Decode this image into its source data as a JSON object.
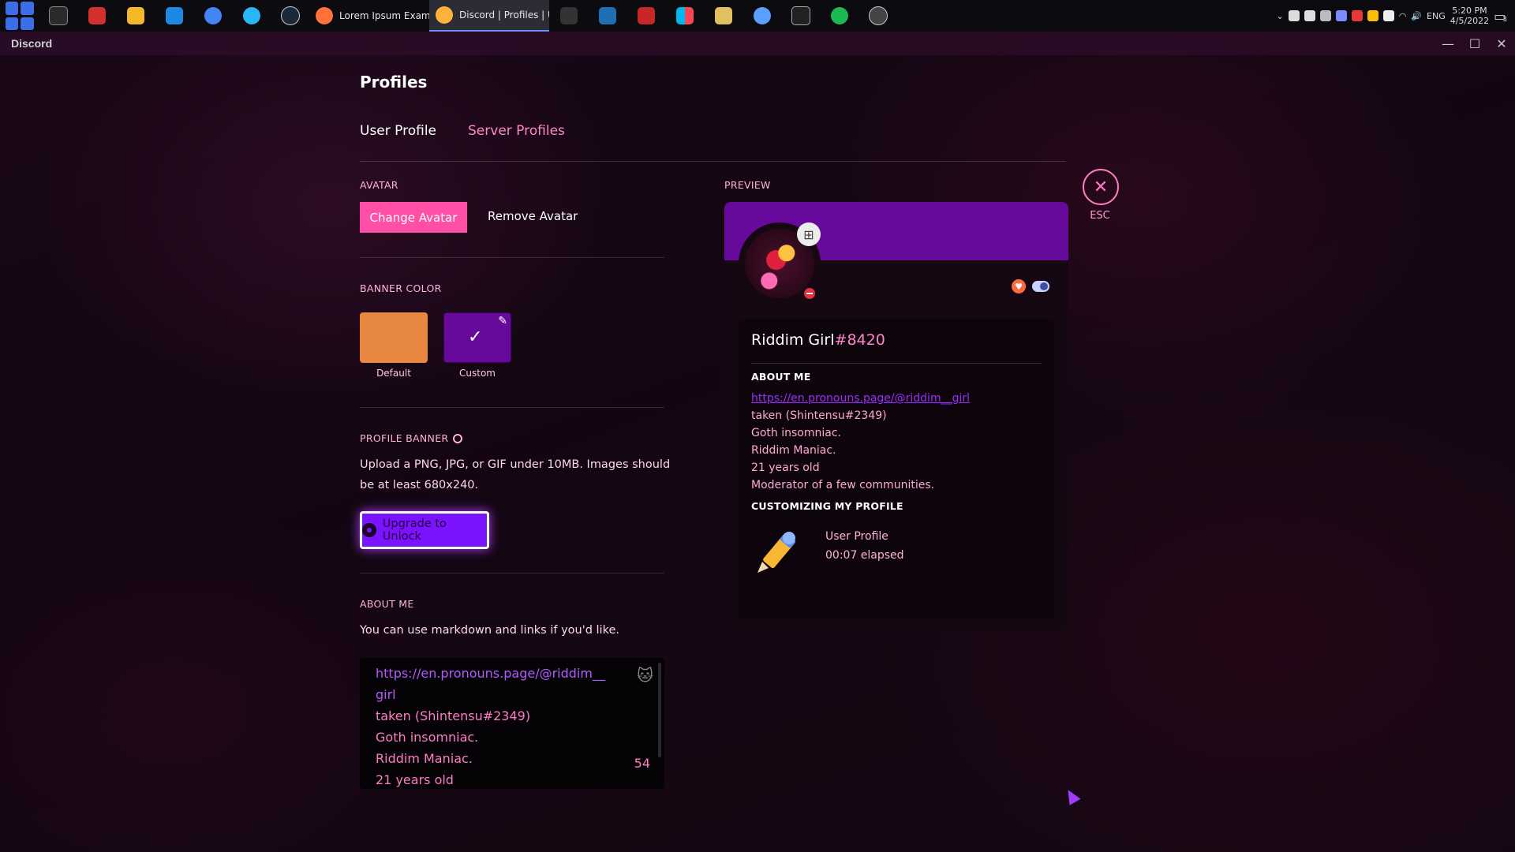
{
  "taskbar": {
    "tabs": [
      {
        "label": "Lorem Ipsum Example...",
        "icon": "firefox-icon",
        "color": "#ff7139"
      },
      {
        "label": "Discord | Profiles | U...",
        "icon": "discord-icon",
        "color": "#ffb13b"
      }
    ],
    "tray": {
      "lang": "ENG",
      "time": "5:20 PM",
      "date": "4/5/2022",
      "notifications": "3"
    }
  },
  "window": {
    "title": "Discord",
    "min": "—",
    "max": "☐",
    "close": "✕"
  },
  "profiles": {
    "heading": "Profiles",
    "tabs": [
      "User Profile",
      "Server Profiles"
    ],
    "active_tab": 0,
    "avatar": {
      "label": "AVATAR",
      "change": "Change Avatar",
      "remove": "Remove Avatar"
    },
    "banner_color": {
      "label": "BANNER COLOR",
      "default_caption": "Default",
      "custom_caption": "Custom",
      "default_color": "#e8873f",
      "custom_color": "#67099b"
    },
    "profile_banner": {
      "label": "PROFILE BANNER",
      "description": "Upload a PNG, JPG, or GIF under 10MB. Images should be at least 680x240.",
      "upgrade_label": "Upgrade to Unlock"
    },
    "about_me": {
      "label": "ABOUT ME",
      "hint": "You can use markdown and links if you'd like.",
      "lines": [
        "https://en.pronouns.page/@riddim__girl",
        "taken (Shintensu#2349)",
        "Goth insomniac.",
        "Riddim Maniac.",
        "21 years old"
      ],
      "remaining": "54"
    },
    "esc_label": "ESC"
  },
  "preview": {
    "label": "PREVIEW",
    "username": "Riddim Girl",
    "discriminator": "#8420",
    "about_label": "ABOUT ME",
    "about_lines": [
      "https://en.pronouns.page/@riddim__girl",
      "taken (Shintensu#2349)",
      "Goth insomniac.",
      "Riddim Maniac.",
      "21 years old",
      "Moderator of a few communities."
    ],
    "activity_label": "CUSTOMIZING MY PROFILE",
    "activity_title": "User Profile",
    "activity_time": "00:07 elapsed",
    "banner_color": "#67099b"
  }
}
